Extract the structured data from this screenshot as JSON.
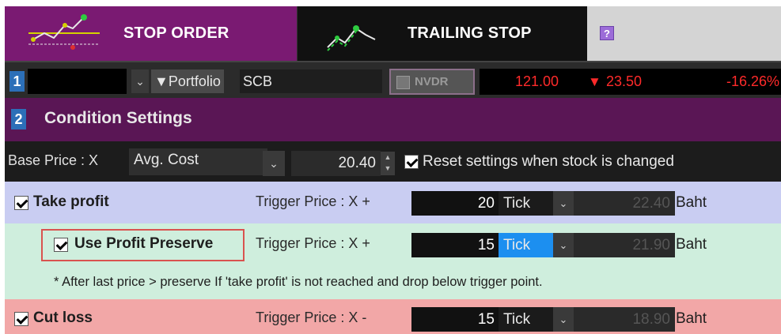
{
  "tabs": {
    "stop_order": "STOP ORDER",
    "trailing_stop": "TRAILING STOP",
    "help_glyph": "?"
  },
  "account_row": {
    "number": "1",
    "portfolio_label": "▼Portfolio",
    "symbol": "SCB",
    "nvdr_label": "NVDR",
    "last_price": "121.00",
    "change_arrow": "▼",
    "change": "23.50",
    "change_percent": "-16.26%"
  },
  "condition_header": {
    "number": "2",
    "title": "Condition Settings"
  },
  "base_price": {
    "label": "Base Price : X",
    "selected_option": "Avg. Cost",
    "value": "20.40",
    "reset_label": "Reset settings when stock is changed",
    "reset_checked": true
  },
  "take_profit": {
    "label": "Take profit",
    "checked": true,
    "trigger_label": "Trigger Price : X +",
    "offset": "20",
    "unit": "Tick",
    "result": "22.40",
    "currency": "Baht"
  },
  "profit_preserve": {
    "label": "Use Profit Preserve",
    "checked": true,
    "trigger_label": "Trigger Price : X +",
    "offset": "15",
    "unit": "Tick",
    "result": "21.90",
    "currency": "Baht",
    "note": "* After last price > preserve If 'take profit' is not reached and drop below trigger point."
  },
  "cut_loss": {
    "label": "Cut loss",
    "checked": true,
    "trigger_label": "Trigger Price : X -",
    "offset": "15",
    "unit": "Tick",
    "result": "18.90",
    "currency": "Baht"
  },
  "colors": {
    "stop_tab": "#7a1a72",
    "condition_header": "#5a1655",
    "take_profit_bg": "#c9cdf2",
    "profit_preserve_bg": "#cfeedd",
    "cut_loss_bg": "#f2a7a7",
    "price_down": "#ff2a2a",
    "selected_blue": "#1c8ff0"
  }
}
